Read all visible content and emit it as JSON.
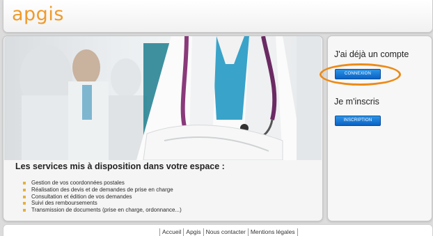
{
  "header": {
    "logo_text": "apgis"
  },
  "hero": {
    "image_subject": "doctors-with-stethoscope-photo"
  },
  "services": {
    "title": "Les services mis à disposition dans votre espace :",
    "items": [
      "Gestion de vos coordonnées postales",
      "Réalisation des devis et de demandes de prise en charge",
      "Consultation et édition de vos demandes",
      "Suivi des remboursements",
      "Transmission de documents (prise en charge, ordonnance...)"
    ]
  },
  "account": {
    "existing_heading": "J'ai déjà un compte",
    "login_button": "CONNEXION",
    "signup_heading": "Je m'inscris",
    "signup_button": "INSCRIPTION"
  },
  "footer": {
    "links": [
      "Accueil",
      "Apgis",
      "Nous contacter",
      "Mentions légales"
    ]
  },
  "colors": {
    "logo": "#f09a2a",
    "button": "#0a62c4",
    "highlight": "#ec8a17",
    "bullet": "#e3b23c"
  }
}
